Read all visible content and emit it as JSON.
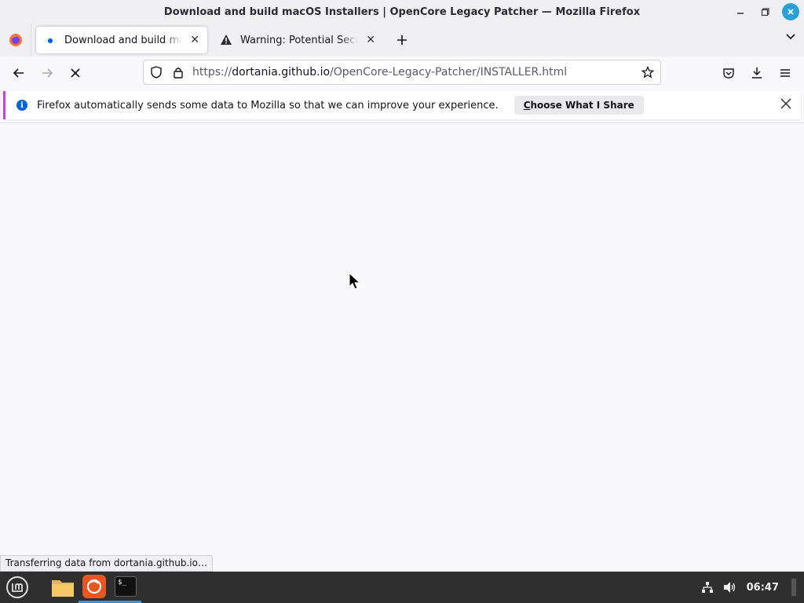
{
  "window": {
    "title": "Download and build macOS Installers | OpenCore Legacy Patcher — Mozilla Firefox",
    "controls": [
      "minimize",
      "maximize",
      "close"
    ]
  },
  "tabs": [
    {
      "label": "Download and build macOS Installers | OpenCore Legacy Patcher",
      "active": true,
      "loading": true
    },
    {
      "label": "Warning: Potential Security Risk Ahead",
      "active": false,
      "icon": "warning-icon"
    }
  ],
  "navbar": {
    "url_prefix": "https://",
    "url_domain": "dortania.github.io",
    "url_path": "/OpenCore-Legacy-Patcher/INSTALLER.html"
  },
  "notification": {
    "message": "Firefox automatically sends some data to Mozilla so that we can improve your experience.",
    "button_label_first": "C",
    "button_label_rest": "hoose What I Share"
  },
  "status": {
    "text": "Transferring data from dortania.github.io…"
  },
  "taskbar": {
    "clock": "06:47",
    "apps": [
      "mint-menu-icon",
      "files-icon",
      "firefox-icon",
      "terminal-icon"
    ]
  }
}
